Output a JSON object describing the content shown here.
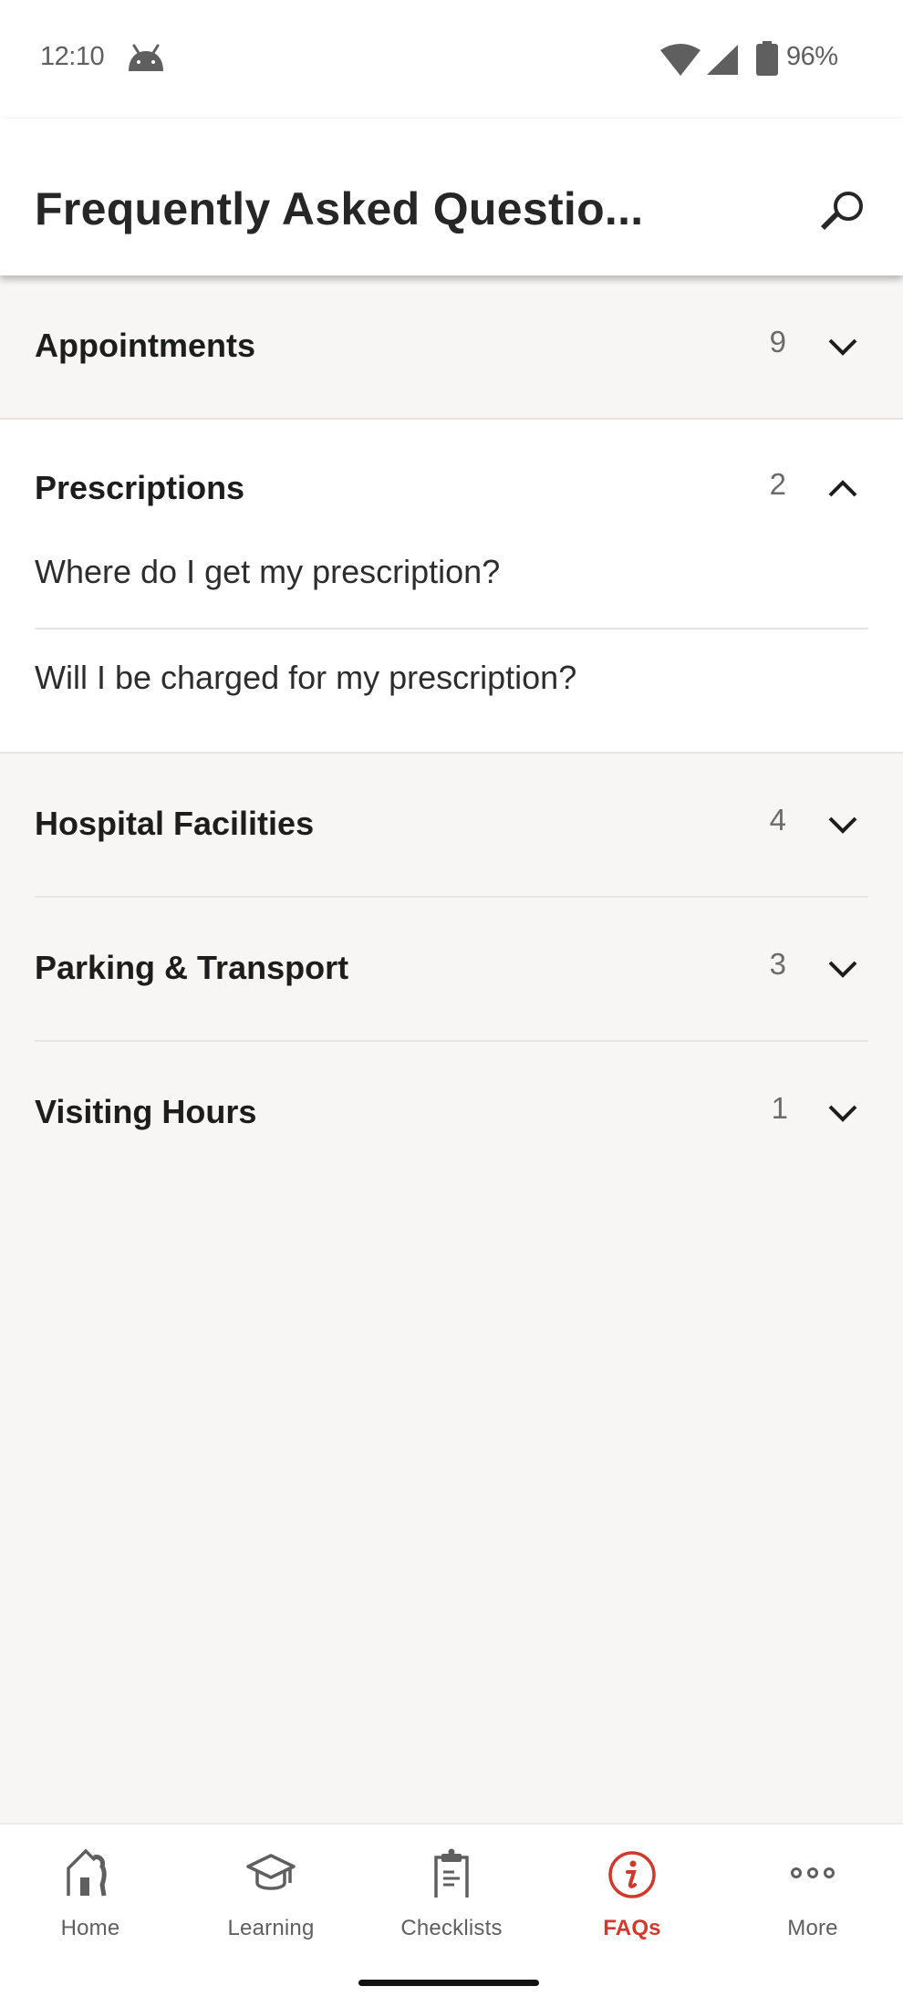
{
  "status_bar": {
    "time": "12:10",
    "battery": "96%",
    "icons": [
      "android-icon",
      "wifi-icon",
      "signal-icon",
      "battery-icon"
    ]
  },
  "app_bar": {
    "title": "Frequently Asked Questio...",
    "search_icon": "search-icon"
  },
  "sections": [
    {
      "title": "Appointments",
      "count": "9",
      "expanded": false
    },
    {
      "title": "Prescriptions",
      "count": "2",
      "expanded": true,
      "questions": [
        "Where do I get my prescription?",
        "Will I be charged for my prescription?"
      ]
    },
    {
      "title": "Hospital Facilities",
      "count": "4",
      "expanded": false
    },
    {
      "title": "Parking & Transport",
      "count": "3",
      "expanded": false
    },
    {
      "title": "Visiting Hours",
      "count": "1",
      "expanded": false
    }
  ],
  "bottom_nav": {
    "items": [
      {
        "label": "Home",
        "icon": "home-icon",
        "active": false
      },
      {
        "label": "Learning",
        "icon": "graduation-cap-icon",
        "active": false
      },
      {
        "label": "Checklists",
        "icon": "clipboard-icon",
        "active": false
      },
      {
        "label": "FAQs",
        "icon": "info-icon",
        "active": true
      },
      {
        "label": "More",
        "icon": "more-dots-icon",
        "active": false
      }
    ]
  },
  "colors": {
    "accent": "#d0392b",
    "text_primary": "#1d1d1d",
    "text_secondary": "#6b6b6b",
    "background": "#f7f6f5",
    "surface": "#ffffff"
  }
}
